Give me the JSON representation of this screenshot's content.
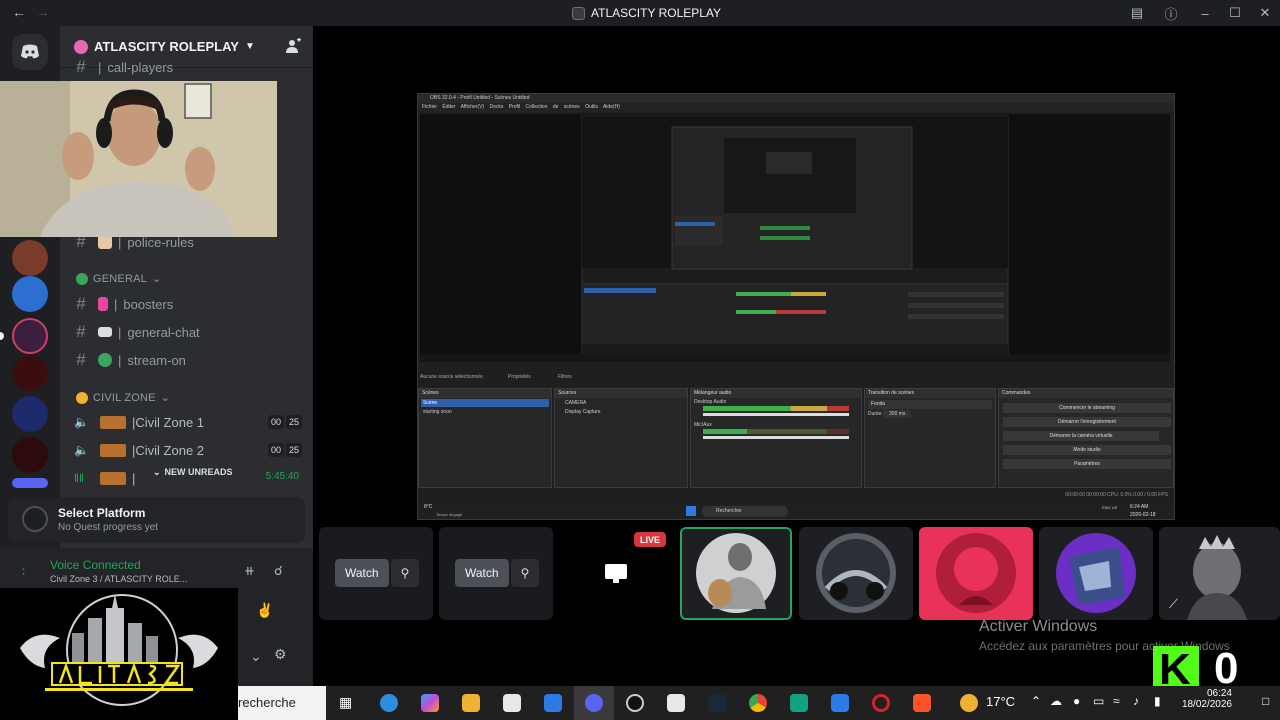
{
  "window": {
    "title": "ATLASCITY ROLEPLAY",
    "back_icon": "arrow-left-icon",
    "forward_icon": "arrow-right-icon"
  },
  "server": {
    "name": "ATLASCITY ROLEPLAY",
    "invite_icon": "add-member-icon"
  },
  "channels": {
    "top_partial": "call-players",
    "police_rules": "police-rules",
    "general_category": "GENERAL",
    "boosters": "boosters",
    "general_chat": "general-chat",
    "stream_on": "stream-on",
    "civil_category": "CIVIL ZONE",
    "civil_zone_1": "Civil Zone 1",
    "civil_zone_2": "Civil Zone 2",
    "cz1_count_a": "00",
    "cz1_count_b": "25",
    "cz2_count_a": "00",
    "cz2_count_b": "25",
    "new_unreads": "NEW UNREADS",
    "timer": "5:45:40",
    "separator": "|"
  },
  "quest": {
    "title": "Select Platform",
    "subtitle": "No Quest progress yet"
  },
  "voice": {
    "status": "Voice Connected",
    "channel": "Civil Zone 3 / ATLASCITY ROLE..."
  },
  "obs": {
    "title": "OBS 32.0.4 - Profil Untitled - Scènes Untitled",
    "menu": "Fichier Éditer Afficher(V) Docks Profil Collection de scènes Outils Aide(H)",
    "no_source": "Aucune source sélectionnée",
    "tab_props": "Propriétés",
    "tab_filters": "Filtres",
    "docks": {
      "scenes": "Scènes",
      "sources": "Sources",
      "mixer": "Mélangeur audio",
      "transitions": "Transition de scènes",
      "controls": "Commandes"
    },
    "scenes": [
      "Scène",
      "starting soon"
    ],
    "sources": [
      "CAMERA",
      "Display Capture"
    ],
    "mixer_tracks": [
      "Desktop Audio",
      "Mic/Aux"
    ],
    "mixer_db": "0.0 dB",
    "transition_value": "Fondu",
    "duration_label": "Durée",
    "duration_value": "300 ms",
    "controls": [
      "Commencer le streaming",
      "Démarrer l'enregistrement",
      "Démarrer la caméra virtuelle",
      "Mode studio",
      "Paramètres"
    ],
    "status": "00:00:00   00:00:00   CPU: 0.0%  0.00 / 0.00 FPS",
    "taskbar_search": "Rechercher",
    "weather": "8°C",
    "weather_sub": "Temps dégagé",
    "clock_time": "6:24 AM",
    "clock_date": "2026-02-18",
    "lang": "ENG US"
  },
  "stream_tiles": {
    "watch_label_1": "Watch",
    "watch_label_2": "Watch",
    "live_badge": "LIVE"
  },
  "watermark": {
    "line1": "Activer Windows",
    "line2": "Accédez aux paramètres pour activer Windows",
    "kick_letter": "K",
    "kick_count": "0"
  },
  "taskbar": {
    "search_label": "recherche",
    "temperature": "17°C",
    "time": "06:24",
    "date": "18/02/2026"
  },
  "colors": {
    "discord_green": "#23a55a",
    "live_red": "#da373c",
    "kick_green": "#53fc18",
    "selected_tile_border": "#23a55a",
    "pink_tile": "#e8325a"
  }
}
